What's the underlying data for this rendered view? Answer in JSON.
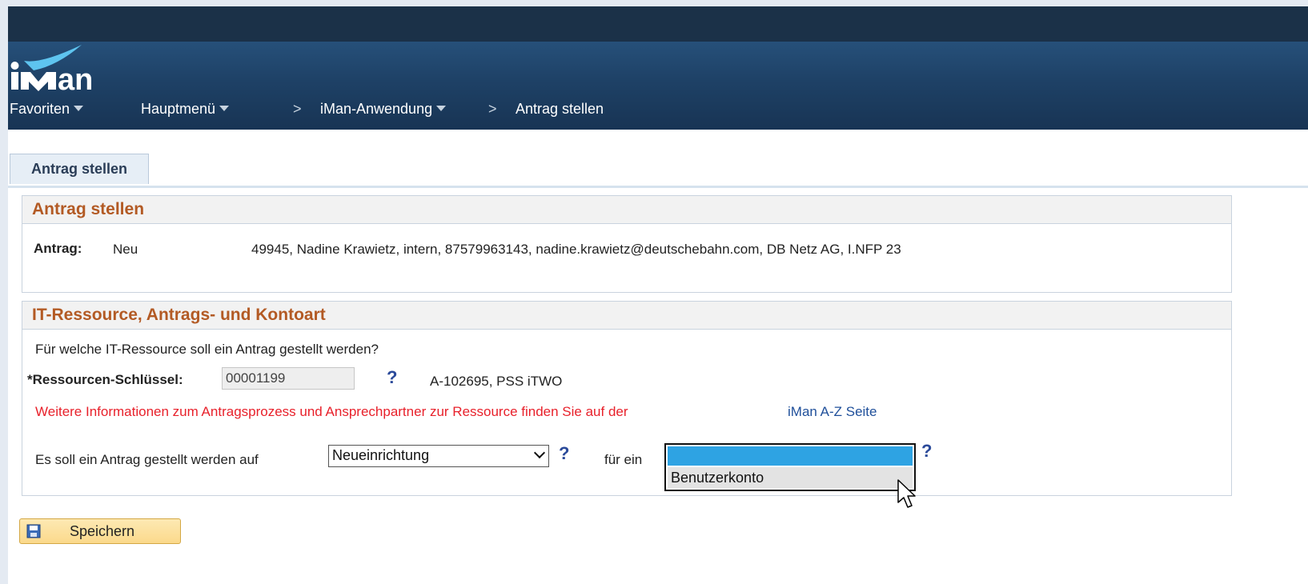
{
  "header": {
    "logo_text": "iMan",
    "nav": [
      {
        "label": "Favoriten",
        "dropdown": true
      },
      {
        "label": "Hauptmenü",
        "dropdown": true
      },
      {
        "label": "iMan-Anwendung",
        "dropdown": true
      },
      {
        "label": "Antrag stellen",
        "dropdown": false
      }
    ],
    "separator": ">"
  },
  "tabs": [
    {
      "label": "Antrag stellen",
      "active": true
    }
  ],
  "section_antrag": {
    "title": "Antrag stellen",
    "antrag_label": "Antrag:",
    "antrag_status": "Neu",
    "antrag_details": "49945, Nadine Krawietz, intern, 87579963143, nadine.krawietz@deutschebahn.com, DB Netz AG, I.NFP 23"
  },
  "section_ressource": {
    "title": "IT-Ressource, Antrags- und Kontoart",
    "question": "Für welche IT-Ressource soll ein Antrag gestellt werden?",
    "key_label": "*Ressourcen-Schlüssel:",
    "key_value": "00001199",
    "help": "?",
    "resource_desc": "A-102695, PSS iTWO",
    "info_text": "Weitere Informationen zum Antragsprozess und Ansprechpartner zur Ressource finden Sie auf der",
    "info_link": "iMan A-Z Seite",
    "request_label": "Es soll ein Antrag gestellt werden auf",
    "request_value": "Neueinrichtung",
    "for_label": "für ein",
    "account_options": [
      "",
      "Benutzerkonto"
    ]
  },
  "toolbar": {
    "save_label": "Speichern"
  },
  "colors": {
    "header_dark": "#1b3148",
    "header_blue": "#1e4166",
    "section_title": "#b35a24",
    "info_red": "#e8212b",
    "link_blue": "#1f4f9a",
    "dropdown_highlight": "#2ea3e3",
    "button_bg": "#fbd98b"
  }
}
